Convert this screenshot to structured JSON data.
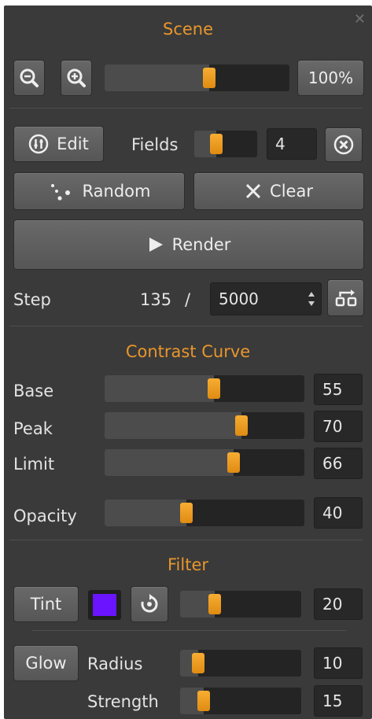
{
  "panel": {
    "title": "Scene",
    "close_glyph": "✕"
  },
  "zoom": {
    "value_label": "100%",
    "level": 0.57
  },
  "fields": {
    "edit_label": "Edit",
    "label": "Fields",
    "value": "4",
    "level": 0.3
  },
  "actions": {
    "random_label": "Random",
    "clear_label": "Clear",
    "render_label": "Render"
  },
  "step": {
    "label": "Step",
    "current": "135",
    "separator": "/",
    "total": "5000"
  },
  "contrast_curve": {
    "title": "Contrast Curve",
    "rows": [
      {
        "label": "Base",
        "value": "55",
        "level": 0.55
      },
      {
        "label": "Peak",
        "value": "70",
        "level": 0.7
      },
      {
        "label": "Limit",
        "value": "66",
        "level": 0.66
      },
      {
        "label": "Opacity",
        "value": "40",
        "level": 0.4
      }
    ]
  },
  "filter": {
    "title": "Filter",
    "tint_label": "Tint",
    "tint_color": "#6a14ff",
    "tint_value": "20",
    "tint_level": 0.25,
    "glow_label": "Glow",
    "radius_label": "Radius",
    "radius_value": "10",
    "radius_level": 0.1,
    "strength_label": "Strength",
    "strength_value": "15",
    "strength_level": 0.15
  },
  "colors": {
    "accent": "#e8962c",
    "panel": "#3a3a3a",
    "slider_thumb": "#f0a02a"
  }
}
